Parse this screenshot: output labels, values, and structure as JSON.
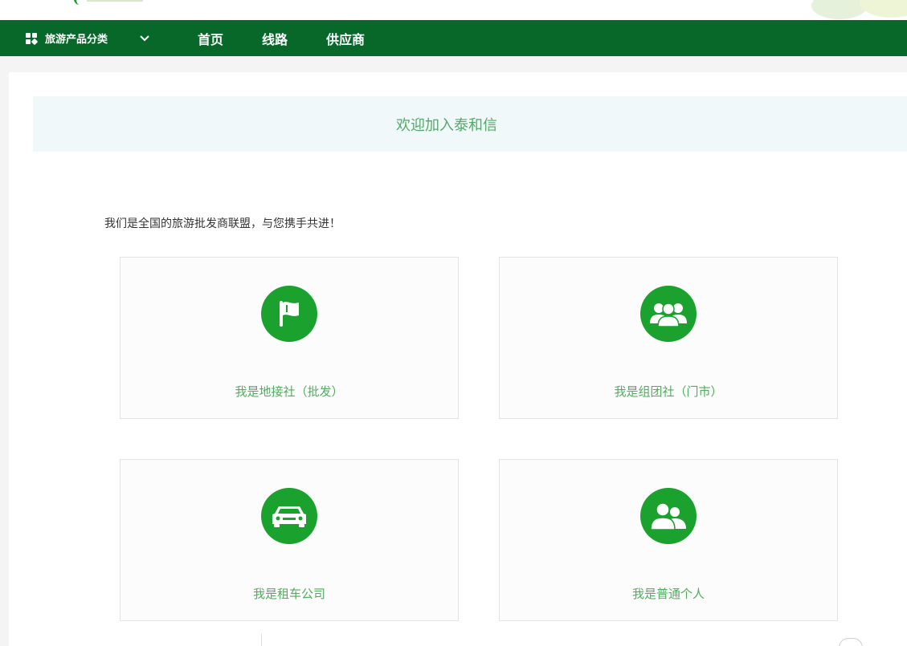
{
  "nav": {
    "category_label": "旅游产品分类",
    "links": [
      "首页",
      "线路",
      "供应商"
    ]
  },
  "welcome": "欢迎加入泰和信",
  "intro": "我们是全国的旅游批发商联盟，与您携手共进！",
  "cards": [
    {
      "label": "我是地接社（批发）",
      "icon": "flag-icon"
    },
    {
      "label": "我是组团社（门市）",
      "icon": "group-icon"
    },
    {
      "label": "我是租车公司",
      "icon": "car-icon"
    },
    {
      "label": "我是普通个人",
      "icon": "users-icon"
    }
  ],
  "colors": {
    "nav_bg": "#08682a",
    "accent_green": "#1aa12e",
    "label_green": "#4fae5d",
    "welcome_bg": "#f0f8fa"
  }
}
